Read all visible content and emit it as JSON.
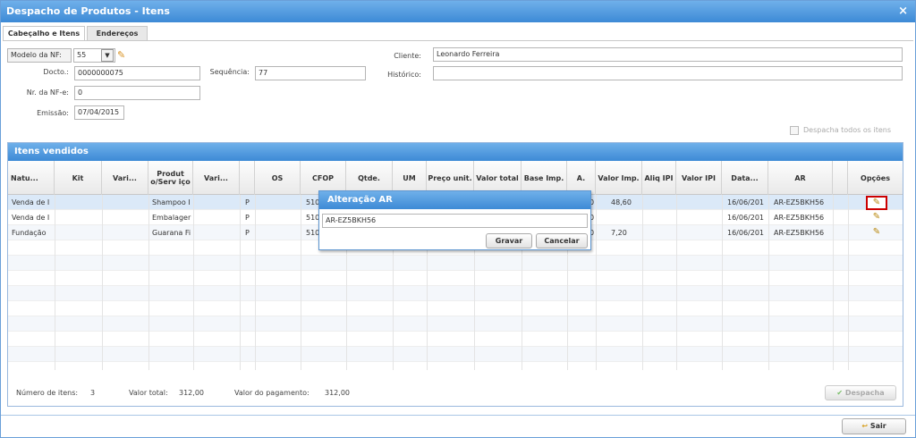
{
  "window": {
    "title": "Despacho de Produtos - Itens",
    "close": "×"
  },
  "tabs": [
    "Cabeçalho e Itens",
    "Endereços"
  ],
  "form": {
    "modelo_label": "Modelo da NF:",
    "modelo_value": "55",
    "docto_label": "Docto.:",
    "docto_value": "0000000075",
    "sequencia_label": "Sequência:",
    "sequencia_value": "77",
    "nrnfe_label": "Nr. da NF-e:",
    "nrnfe_value": "0",
    "emissao_label": "Emissão:",
    "emissao_value": "07/04/2015",
    "cliente_label": "Cliente:",
    "cliente_value": "Leonardo Ferreira",
    "historico_label": "Histórico:",
    "historico_value": "",
    "despacha_todos": "Despacha todos os itens"
  },
  "grid": {
    "title": "Itens vendidos",
    "columns": [
      "Natu...",
      "Kit",
      "Vari...",
      "Produt o/Serv iço",
      "Vari...",
      "",
      "OS",
      "CFOP",
      "Qtde.",
      "UM",
      "Preço unit.",
      "Valor total",
      "Base Imp.",
      "A.",
      "Valor Imp.",
      "Aliq IPI",
      "Valor IPI",
      "Data...",
      "AR",
      "",
      "Opções"
    ],
    "rows": [
      {
        "natu": "Venda de I",
        "produto": "Shampoo I",
        "p": "P",
        "cfop": "510",
        "a": "0",
        "valor_imp": "48,60",
        "data": "16/06/201",
        "ar": "AR-EZ5BKH56"
      },
      {
        "natu": "Venda de I",
        "produto": "Embalager",
        "p": "P",
        "cfop": "510",
        "a": "0",
        "valor_imp": "",
        "data": "16/06/201",
        "ar": "AR-EZ5BKH56"
      },
      {
        "natu": "Fundação",
        "produto": "Guarana Fi",
        "p": "P",
        "cfop": "510",
        "a": "0",
        "valor_imp": "7,20",
        "data": "16/06/201",
        "ar": "AR-EZ5BKH56"
      }
    ]
  },
  "footer": {
    "num_itens_label": "Número de itens:",
    "num_itens": "3",
    "valor_total_label": "Valor total:",
    "valor_total": "312,00",
    "valor_pag_label": "Valor do pagamento:",
    "valor_pag": "312,00",
    "despacha_btn": "Despacha"
  },
  "dialog": {
    "title": "Alteração AR",
    "value": "AR-EZ5BKH56",
    "gravar": "Gravar",
    "cancelar": "Cancelar"
  },
  "sair": "Sair"
}
